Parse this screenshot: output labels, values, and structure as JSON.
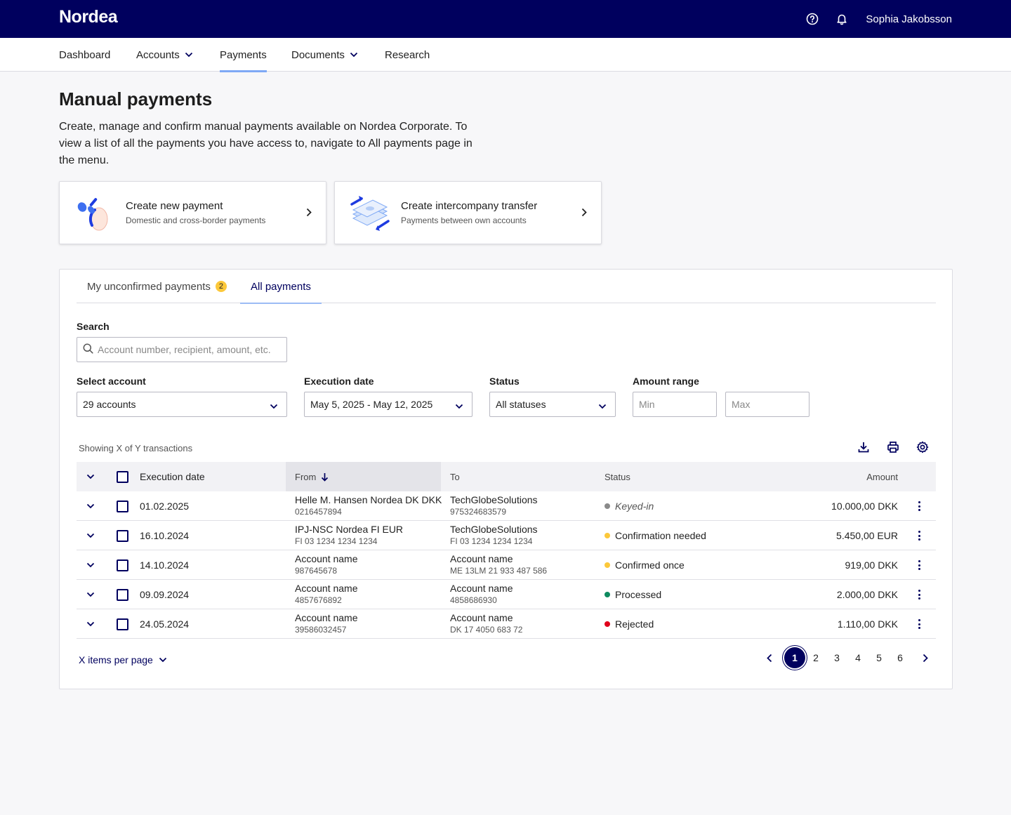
{
  "header": {
    "logo": "Nordea",
    "user_name": "Sophia Jakobsson",
    "icons": [
      "help-icon",
      "bell-icon"
    ]
  },
  "nav": {
    "items": [
      {
        "label": "Dashboard",
        "dropdown": false
      },
      {
        "label": "Accounts",
        "dropdown": true
      },
      {
        "label": "Payments",
        "dropdown": false,
        "active": true
      },
      {
        "label": "Documents",
        "dropdown": true
      },
      {
        "label": "Research",
        "dropdown": false
      }
    ]
  },
  "page": {
    "title": "Manual payments",
    "description": "Create, manage and confirm manual payments available on Nordea Corporate. To view a list of all the payments you have access to, navigate to All payments page in the menu."
  },
  "actions": [
    {
      "title": "Create new payment",
      "subtitle": "Domestic and cross-border payments"
    },
    {
      "title": "Create intercompany transfer",
      "subtitle": "Payments between own accounts"
    }
  ],
  "tabs": [
    {
      "label": "My unconfirmed payments",
      "badge": "2"
    },
    {
      "label": "All payments",
      "active": true
    }
  ],
  "filters": {
    "search_label": "Search",
    "search_placeholder": "Account number, recipient, amount, etc.",
    "account_label": "Select account",
    "account_value": "29 accounts",
    "date_label": "Execution date",
    "date_value": "May 5, 2025 - May 12, 2025",
    "status_label": "Status",
    "status_value": "All statuses",
    "amount_label": "Amount range",
    "amount_min_placeholder": "Min",
    "amount_max_placeholder": "Max"
  },
  "table": {
    "showing": "Showing X of Y transactions",
    "columns": {
      "date": "Execution date",
      "from": "From",
      "to": "To",
      "status": "Status",
      "amount": "Amount"
    },
    "rows": [
      {
        "date": "01.02.2025",
        "from_name": "Helle M. Hansen Nordea DK DKK",
        "from_acc": "0216457894",
        "to_name": "TechGlobeSolutions",
        "to_acc": "975324683579",
        "status": "Keyed-in",
        "status_color": "#8a8a8a",
        "amount": "10.000,00 DKK"
      },
      {
        "date": "16.10.2024",
        "from_name": "IPJ-NSC Nordea FI EUR",
        "from_acc": "FI 03 1234 1234 1234",
        "to_name": "TechGlobeSolutions",
        "to_acc": "FI 03 1234 1234 1234",
        "status": "Confirmation needed",
        "status_color": "#fcc83a",
        "amount": "5.450,00 EUR"
      },
      {
        "date": "14.10.2024",
        "from_name": "Account name",
        "from_acc": "987645678",
        "to_name": "Account name",
        "to_acc": "ME 13LM 21 933 487 586",
        "status": "Confirmed once",
        "status_color": "#fcc83a",
        "amount": "919,00 DKK"
      },
      {
        "date": "09.09.2024",
        "from_name": "Account name",
        "from_acc": "4857676892",
        "to_name": "Account name",
        "to_acc": "4858686930",
        "status": "Processed",
        "status_color": "#0e8a5f",
        "amount": "2.000,00 DKK"
      },
      {
        "date": "24.05.2024",
        "from_name": "Account name",
        "from_acc": "39586032457",
        "to_name": "Account name",
        "to_acc": "DK 17 4050 683 72",
        "status": "Rejected",
        "status_color": "#e0001b",
        "amount": "1.110,00 DKK"
      }
    ]
  },
  "footer": {
    "per_page": "X items per page",
    "pages": [
      "1",
      "2",
      "3",
      "4",
      "5",
      "6"
    ],
    "current_page": "1"
  },
  "colors": {
    "brand": "#00005e",
    "accent": "#7fa9f5",
    "badge": "#fcc83a"
  }
}
